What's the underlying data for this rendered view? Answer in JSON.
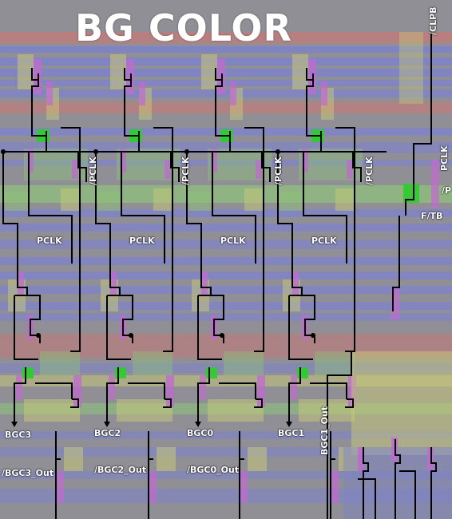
{
  "title": "BG COLOR",
  "colors": {
    "background": "#8f8f95",
    "metal_blue": "#7f83c8",
    "metal_red": "#c07a7a",
    "diffusion_green": "#8fc27a",
    "diffusion_yellow": "#c9c97a",
    "poly_magenta": "#c06ad0",
    "contact_green": "#2ecc2e",
    "wire": "#000000",
    "label": "#ffffff"
  },
  "labels": {
    "pclk_vertical": [
      "/PCLK",
      "/PCLK",
      "/PCLK",
      "/PCLK"
    ],
    "pclk_horizontal": [
      "PCLK",
      "PCLK",
      "PCLK",
      "PCLK"
    ],
    "bgc": [
      "BGC3",
      "BGC2",
      "BGC0",
      "BGC1"
    ],
    "bgc_out": [
      "/BGC3_Out",
      "/BGC2_Out",
      "/BGC0_Out"
    ],
    "bgc1_out": "BGC1_Out",
    "clpb": "/CLPB",
    "pclk_right": "PCLK",
    "p_right": "/P",
    "ftb": "F/TB"
  }
}
